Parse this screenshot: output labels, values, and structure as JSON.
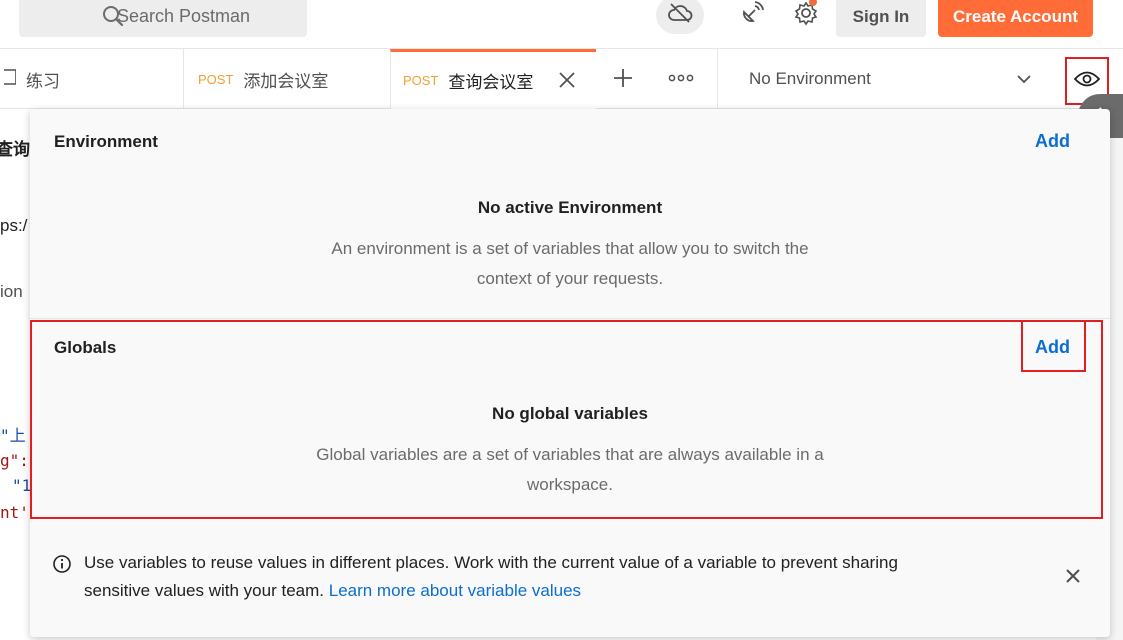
{
  "topbar": {
    "search_placeholder": "Search Postman",
    "signin_label": "Sign In",
    "create_account_label": "Create Account",
    "icons": [
      "search-icon",
      "cloud-offline-icon",
      "satellite-icon",
      "gear-icon"
    ],
    "accent_color": "#ff6c37"
  },
  "tabs": [
    {
      "method": "",
      "label": "练习"
    },
    {
      "method": "POST",
      "label": "添加会议室"
    },
    {
      "method": "POST",
      "label": "查询会议室"
    }
  ],
  "environment_selector": {
    "value": "No Environment"
  },
  "background": {
    "title_fragment": "查询会",
    "url_fragment": "ps:/",
    "text_fragment": "ion",
    "code_lines": [
      "\"上",
      "g\":",
      "\"1",
      "nt'"
    ]
  },
  "panel": {
    "environment": {
      "title": "Environment",
      "add_label": "Add",
      "empty_title": "No active Environment",
      "empty_desc_line1": "An environment is a set of variables that allow you to switch the",
      "empty_desc_line2": "context of your requests."
    },
    "globals": {
      "title": "Globals",
      "add_label": "Add",
      "empty_title": "No global variables",
      "empty_desc_line1": "Global variables are a set of variables that are always available in a",
      "empty_desc_line2": "workspace."
    },
    "info": {
      "text_line1": "Use variables to reuse values in different places. Work with the current value of a variable to prevent sharing",
      "text_line2": "sensitive values with your team.",
      "link_label": "Learn more about variable values"
    },
    "link_color": "#0b6ed0",
    "highlight_color": "#e02020"
  }
}
